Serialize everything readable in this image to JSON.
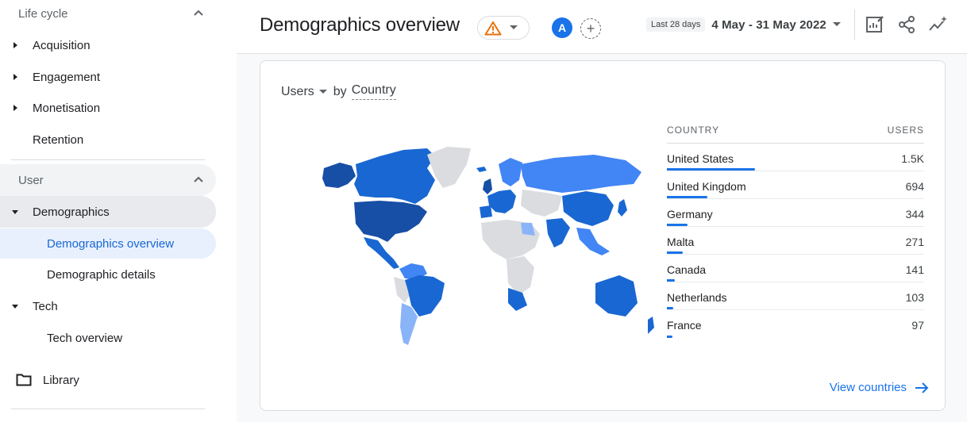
{
  "sidebar": {
    "lifecycle_header": "Life cycle",
    "lifecycle_items": [
      "Acquisition",
      "Engagement",
      "Monetisation",
      "Retention"
    ],
    "user_header": "User",
    "demographics": "Demographics",
    "demographics_overview": "Demographics overview",
    "demographic_details": "Demographic details",
    "tech": "Tech",
    "tech_overview": "Tech overview",
    "library": "Library"
  },
  "header": {
    "title": "Demographics overview",
    "avatar_letter": "A",
    "add_compare": "+",
    "date_chip": "Last 28 days",
    "date_range": "4 May - 31 May 2022"
  },
  "card": {
    "metric": "Users",
    "by": "by",
    "dimension": "Country",
    "table": {
      "col1": "COUNTRY",
      "col2": "USERS",
      "rows": [
        {
          "country": "United States",
          "users": "1.5K",
          "share": 1.0
        },
        {
          "country": "United Kingdom",
          "users": "694",
          "share": 0.46
        },
        {
          "country": "Germany",
          "users": "344",
          "share": 0.23
        },
        {
          "country": "Malta",
          "users": "271",
          "share": 0.18
        },
        {
          "country": "Canada",
          "users": "141",
          "share": 0.09
        },
        {
          "country": "Netherlands",
          "users": "103",
          "share": 0.07
        },
        {
          "country": "France",
          "users": "97",
          "share": 0.065
        }
      ]
    },
    "view_link": "View countries"
  },
  "colors": {
    "accent": "#1a73e8",
    "map_dark": "#174ea6",
    "map_mid": "#1967d2",
    "map_light": "#4285f4",
    "map_pale": "#8ab4f8",
    "map_none": "#dadce0"
  },
  "icons": [
    "chevron-up-icon",
    "caret-right-icon",
    "caret-down-icon",
    "folder-icon",
    "warning-icon",
    "customize-report-icon",
    "share-icon",
    "insights-icon",
    "arrow-right-icon"
  ]
}
